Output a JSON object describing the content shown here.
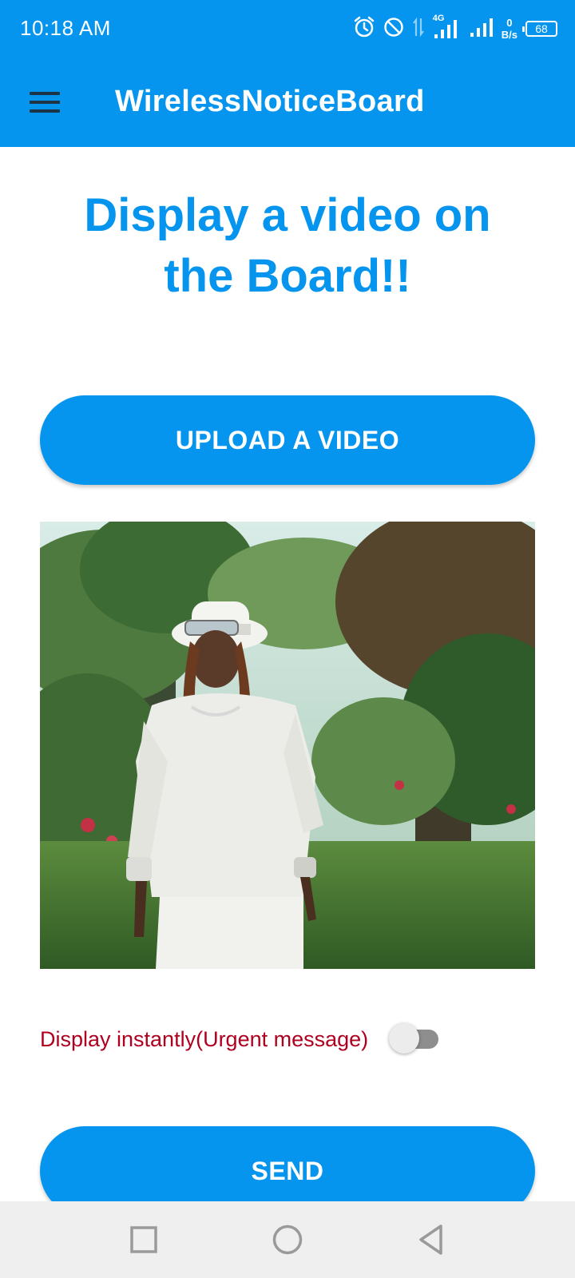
{
  "status_bar": {
    "time": "10:18 AM",
    "network_type": "4G",
    "net_speed_value": "0",
    "net_speed_unit": "B/s",
    "battery": "68",
    "icons": [
      "alarm-icon",
      "do-not-disturb-icon",
      "data-transfer-icon",
      "signal-icon",
      "signal-icon-2",
      "battery-icon"
    ]
  },
  "app_bar": {
    "title": "WirelessNoticeBoard",
    "menu_icon": "hamburger-menu-icon"
  },
  "main": {
    "heading": "Display a video on the Board!!",
    "upload_button_label": "UPLOAD A VIDEO",
    "urgent_label": "Display instantly(Urgent message)",
    "urgent_toggle_on": false,
    "send_button_label": "SEND"
  },
  "nav_bar": {
    "icons": [
      "recents-square-icon",
      "home-circle-icon",
      "back-triangle-icon"
    ]
  },
  "colors": {
    "primary": "#0595ee",
    "white": "#ffffff",
    "urgent_text": "#b00020",
    "nav_bar_bg": "#efefef"
  }
}
